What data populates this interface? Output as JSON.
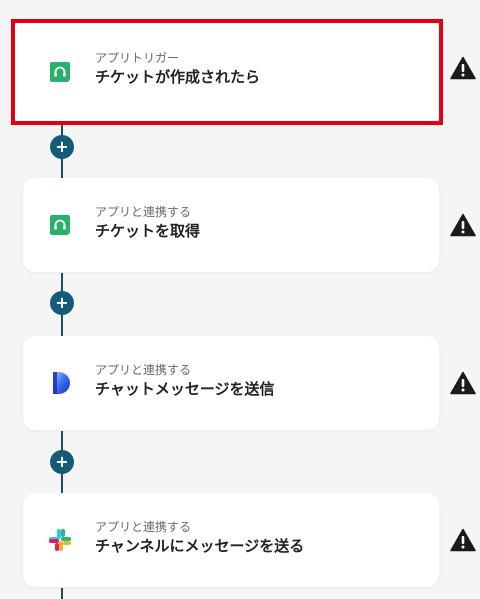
{
  "flow": {
    "steps": [
      {
        "caption": "アプリトリガー",
        "title": "チケットが作成されたら",
        "icon": "headset-app-icon",
        "selected": true
      },
      {
        "caption": "アプリと連携する",
        "title": "チケットを取得",
        "icon": "headset-app-icon",
        "selected": false
      },
      {
        "caption": "アプリと連携する",
        "title": "チャットメッセージを送信",
        "icon": "d-app-icon",
        "selected": false
      },
      {
        "caption": "アプリと連携する",
        "title": "チャンネルにメッセージを送る",
        "icon": "slack-icon",
        "selected": false
      }
    ],
    "add_button_glyph": "+",
    "colors": {
      "selected_border": "#e20012",
      "connector": "#1f4b6b",
      "add_button": "#145b7a",
      "headset_green": "#27b26b",
      "warning": "#1b1b1b"
    }
  }
}
